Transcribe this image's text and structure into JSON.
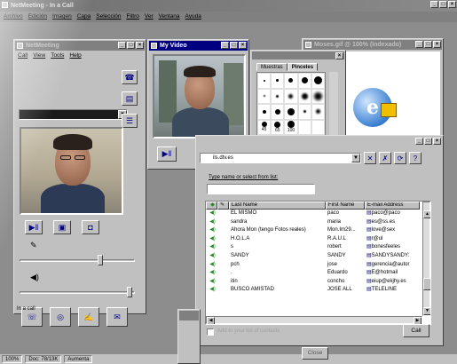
{
  "app": {
    "title": "NetMeeting - In a Call",
    "menu": [
      "Archivo",
      "Edición",
      "Imagen",
      "Capa",
      "Selección",
      "Filtro",
      "Ver",
      "Ventana",
      "Ayuda"
    ],
    "status": [
      "100%",
      "Doc: 78/13K",
      "Aumenta"
    ]
  },
  "netmeeting": {
    "title": "NetMeeting",
    "menu": [
      "Call",
      "View",
      "Tools",
      "Help"
    ],
    "status_text": "In a call"
  },
  "my_video": {
    "title": "My Video"
  },
  "paint": {
    "tabs": [
      "Muestras",
      "Pinceles"
    ],
    "brush_labels": [
      "45",
      "65",
      "100"
    ]
  },
  "image_window": {
    "title": "Moses.gif @ 100% (Indexado)"
  },
  "address_book": {
    "directory": "ils.dtv.es",
    "type_label": "Type name or select from list:",
    "search_value": "",
    "columns": [
      "Last Name",
      "First Name",
      "E-mail Address"
    ],
    "rows": [
      {
        "last": "EL MISMO",
        "first": "paco",
        "email": "paco@paco"
      },
      {
        "last": "sandra",
        "first": "maria",
        "email": "es@ss.es"
      },
      {
        "last": "Ahora Mon (tengo Fotos reales)",
        "first": "Mon.Im29...",
        "email": "love@sex"
      },
      {
        "last": "H.O.L.A",
        "first": "R.A.U.L",
        "email": "r@ul"
      },
      {
        "last": "s",
        "first": "robert",
        "email": "bonesfeeles"
      },
      {
        "last": "SANDY",
        "first": "SANDY",
        "email": "SANDYSANDY:"
      },
      {
        "last": "pch",
        "first": "jose",
        "email": "gerencia@autor"
      },
      {
        "last": ".",
        "first": "Eduardo",
        "email": "E@hotmail"
      },
      {
        "last": "itin",
        "first": "concho",
        "email": "eiup@ekjhy.es"
      },
      {
        "last": "BUSCO AMISTAD",
        "first": "JOSE ALL",
        "email": "TELELINE"
      }
    ],
    "checkbox_label": "Add to your list of contacts",
    "call_button": "Call",
    "close_button": "Close"
  }
}
